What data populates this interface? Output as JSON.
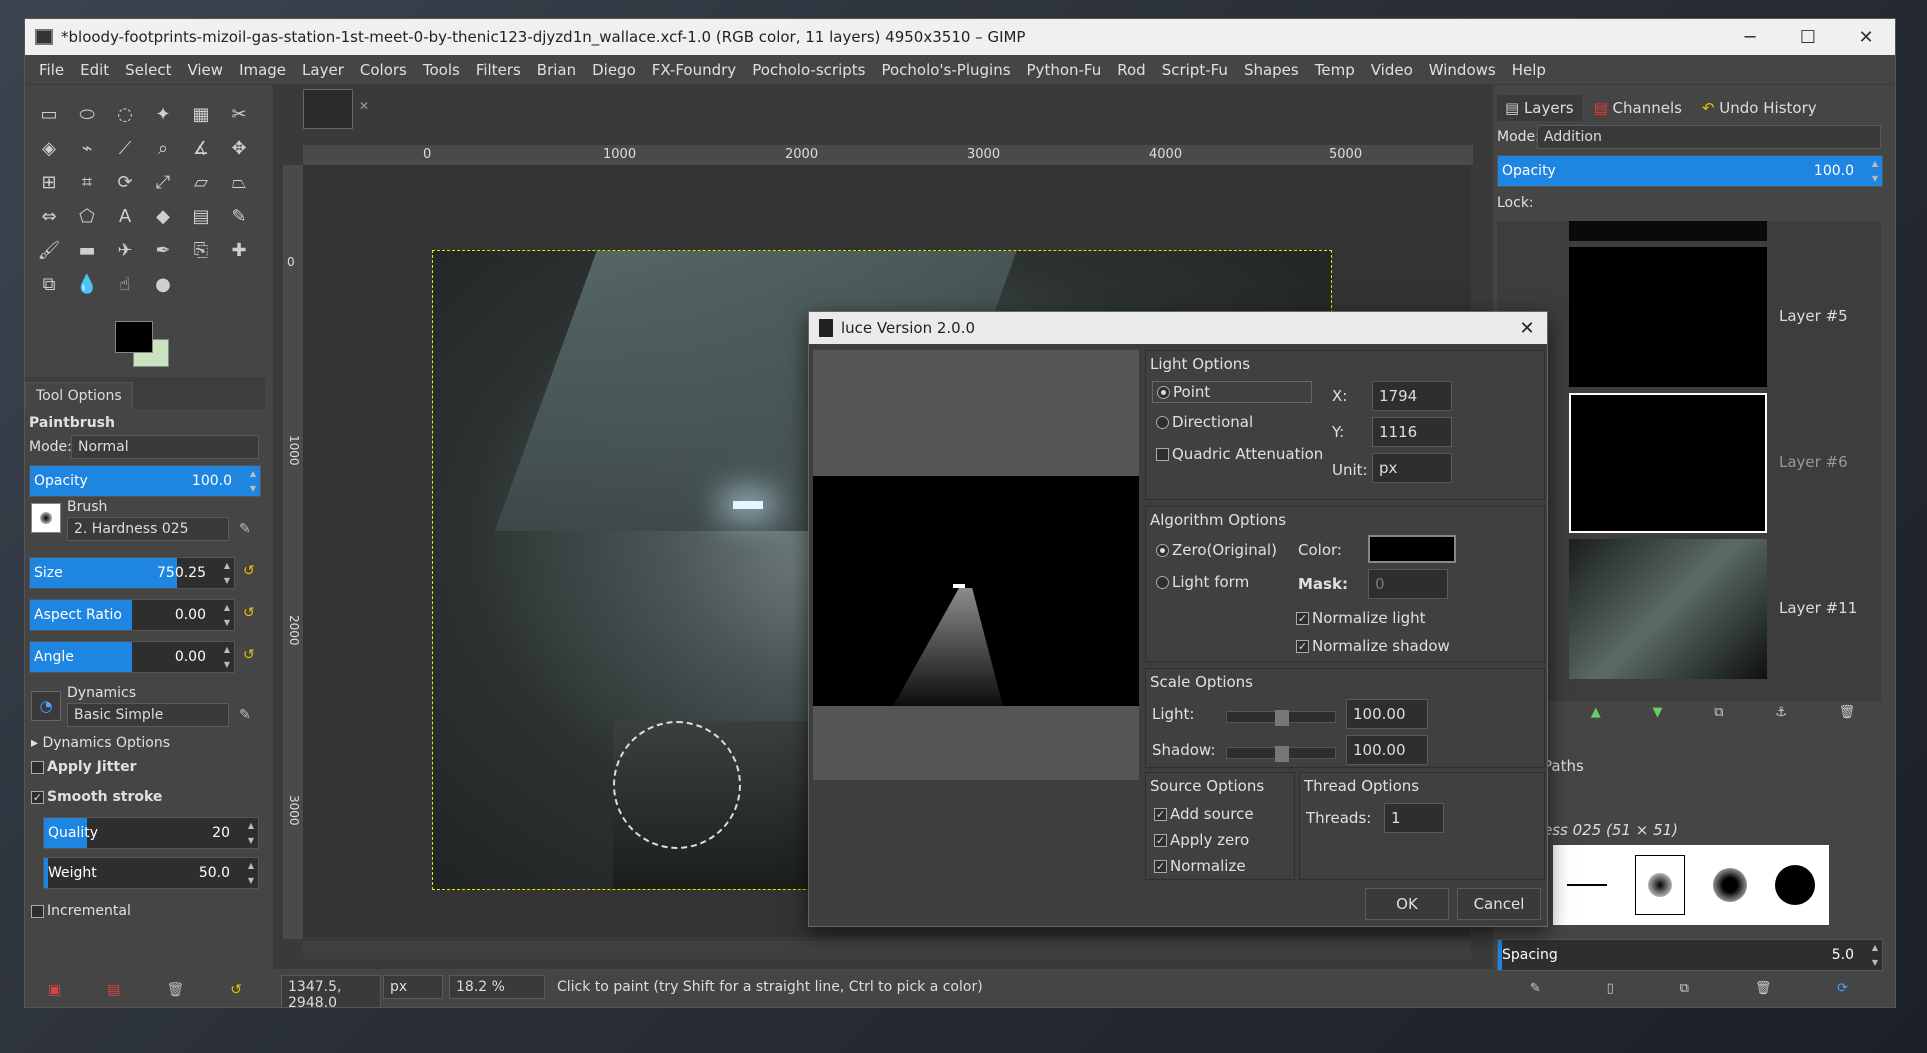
{
  "window": {
    "title": "*bloody-footprints-mizoil-gas-station-1st-meet-0-by-thenic123-djyzd1n_wallace.xcf-1.0 (RGB color, 11 layers) 4950x3510 – GIMP",
    "minimize": "─",
    "maximize": "☐",
    "close": "✕"
  },
  "menu": [
    "File",
    "Edit",
    "Select",
    "View",
    "Image",
    "Layer",
    "Colors",
    "Tools",
    "Filters",
    "Brian",
    "Diego",
    "FX-Foundry",
    "Pocholo-scripts",
    "Pocholo's-Plugins",
    "Python-Fu",
    "Rod",
    "Script-Fu",
    "Shapes",
    "Temp",
    "Video",
    "Windows",
    "Help"
  ],
  "tool_options": {
    "tab": "Tool Options",
    "tool_name": "Paintbrush",
    "mode_label": "Mode:",
    "mode_value": "Normal",
    "opacity_label": "Opacity",
    "opacity_value": "100.0",
    "opacity_fraction": 1.0,
    "brush_label": "Brush",
    "brush_value": "2. Hardness 025",
    "size_label": "Size",
    "size_value": "750.25",
    "size_fraction": 0.72,
    "aspect_label": "Aspect Ratio",
    "aspect_value": "0.00",
    "aspect_fraction": 0.5,
    "angle_label": "Angle",
    "angle_value": "0.00",
    "angle_fraction": 0.5,
    "dynamics_label": "Dynamics",
    "dynamics_value": "Basic Simple",
    "dynamics_options": "Dynamics Options",
    "apply_jitter": "Apply Jitter",
    "smooth_stroke": "Smooth stroke",
    "quality_label": "Quality",
    "quality_value": "20",
    "quality_fraction": 0.2,
    "weight_label": "Weight",
    "weight_value": "50.0",
    "weight_fraction": 0.02,
    "incremental": "Incremental"
  },
  "ruler": {
    "h_ticks": [
      "0",
      "1000",
      "2000",
      "3000",
      "4000",
      "5000"
    ],
    "v_ticks": [
      "0",
      "1000",
      "2000",
      "3000"
    ]
  },
  "status": {
    "coords": "1347.5, 2948.0",
    "unit": "px",
    "zoom": "18.2 %",
    "message": "Click to paint (try Shift for a straight line, Ctrl to pick a color)"
  },
  "layers_panel": {
    "tabs": [
      "Layers",
      "Channels",
      "Undo History"
    ],
    "mode_label": "Mode:",
    "mode_value": "Addition",
    "opacity_label": "Opacity",
    "opacity_value": "100.0",
    "lock_label": "Lock:",
    "layers": [
      "Layer #5",
      "Layer #6",
      "Layer #11"
    ]
  },
  "brushes_panel": {
    "paths_tab": "Paths",
    "brush_name": "ess 025 (51 × 51)",
    "spacing_label": "Spacing",
    "spacing_value": "5.0"
  },
  "dialog": {
    "title": "luce Version 2.0.0",
    "light_options": "Light Options",
    "point": "Point",
    "directional": "Directional",
    "quadric": "Quadric Attenuation",
    "x_label": "X:",
    "x_value": "1794",
    "y_label": "Y:",
    "y_value": "1116",
    "unit_label": "Unit:",
    "unit_value": "px",
    "algorithm_options": "Algorithm Options",
    "zero_original": "Zero(Original)",
    "light_form": "Light form",
    "color_label": "Color:",
    "mask_label": "Mask:",
    "mask_value": "0",
    "normalize_light": "Normalize light",
    "normalize_shadow": "Normalize shadow",
    "scale_options": "Scale Options",
    "light_label": "Light:",
    "light_value": "100.00",
    "shadow_label": "Shadow:",
    "shadow_value": "100.00",
    "source_options": "Source Options",
    "add_source": "Add source",
    "apply_zero": "Apply zero",
    "normalize": "Normalize",
    "thread_options": "Thread Options",
    "threads_label": "Threads:",
    "threads_value": "1",
    "ok": "OK",
    "cancel": "Cancel"
  }
}
